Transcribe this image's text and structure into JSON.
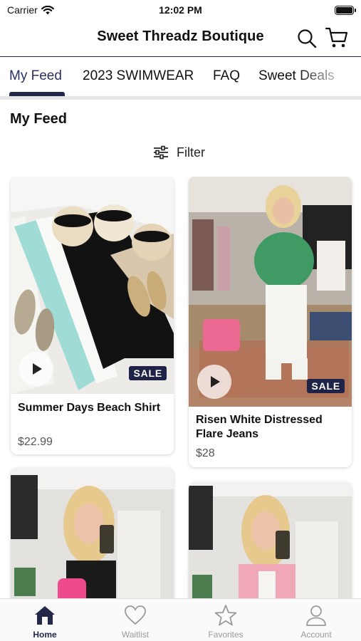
{
  "status_bar": {
    "carrier": "Carrier",
    "time": "12:02 PM"
  },
  "header": {
    "title": "Sweet Threadz Boutique",
    "icons": [
      "search-icon",
      "cart-icon"
    ]
  },
  "tabs": [
    {
      "label": "My Feed",
      "active": true
    },
    {
      "label": "2023 SWIMWEAR",
      "active": false
    },
    {
      "label": "FAQ",
      "active": false
    },
    {
      "label": "Sweet Deals",
      "active": false
    }
  ],
  "feed": {
    "title": "My Feed",
    "filter_label": "Filter"
  },
  "products": [
    {
      "name": "Summer Days Beach Shirt",
      "price": "$22.99",
      "badge": "SALE",
      "has_video": true
    },
    {
      "name": "Risen White Distressed Flare Jeans",
      "price": "$28",
      "badge": "SALE",
      "has_video": true
    },
    {
      "name": "",
      "price": "",
      "badge": "",
      "has_video": false
    },
    {
      "name": "",
      "price": "",
      "badge": "",
      "has_video": false
    }
  ],
  "tabbar": [
    {
      "label": "Home",
      "icon": "home-icon",
      "active": true
    },
    {
      "label": "Waitlist",
      "icon": "heart-icon",
      "active": false
    },
    {
      "label": "Favorites",
      "icon": "star-icon",
      "active": false
    },
    {
      "label": "Account",
      "icon": "person-icon",
      "active": false
    }
  ],
  "colors": {
    "navy": "#23284a",
    "inactive": "#9a9a9a",
    "sale_bg": "#1e2347"
  }
}
